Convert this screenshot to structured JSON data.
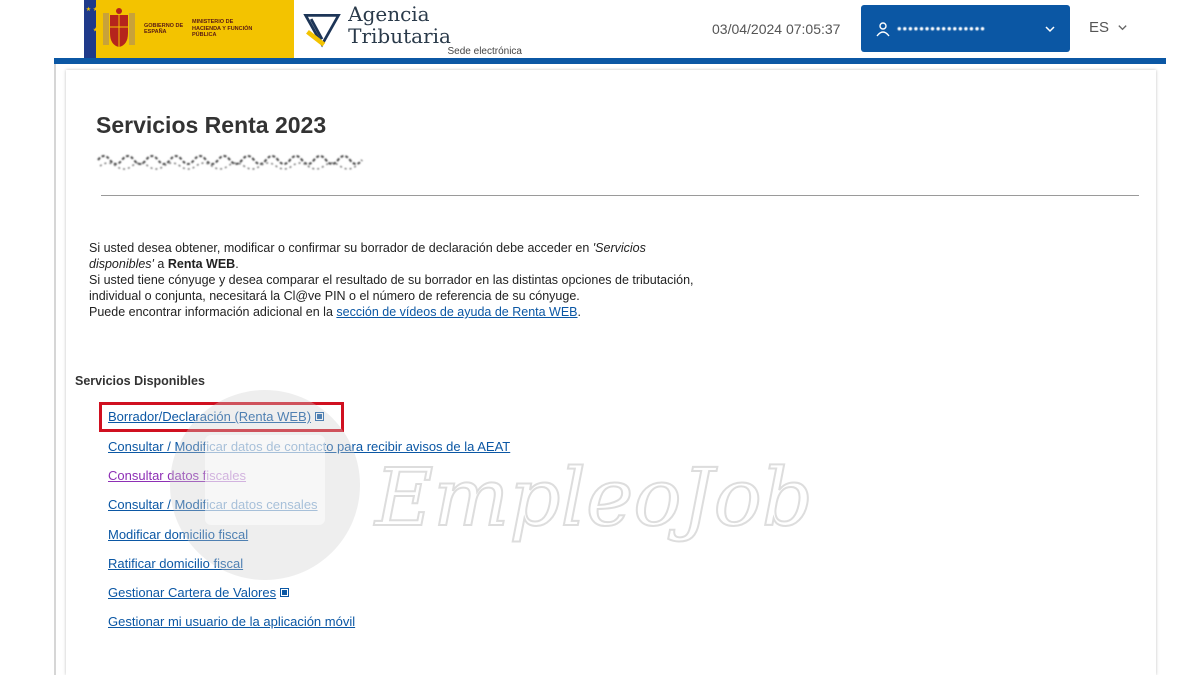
{
  "header": {
    "gov_text_1": "GOBIERNO DE ESPAÑA",
    "gov_text_2": "MINISTERIO DE HACIENDA Y FUNCIÓN PÚBLICA",
    "brand": "Agencia Tributaria",
    "brand_sub": "Sede electrónica",
    "datetime": "03/04/2024 07:05:37",
    "user_name": "••••••••••••••••",
    "language": "ES"
  },
  "main": {
    "title": "Servicios Renta 2023",
    "intro_1a": "Si usted desea obtener, modificar o confirmar su borrador de declaración debe acceder en ",
    "intro_1b": "'Servicios disponibles'",
    "intro_1c": " a ",
    "intro_1d": "Renta WEB",
    "intro_1e": ".",
    "intro_2": "Si usted tiene cónyuge y desea comparar el resultado de su borrador en las distintas opciones de tributación, individual o conjunta, necesitará la Cl@ve PIN o el número de referencia de su cónyuge.",
    "intro_3a": "Puede encontrar información adicional en la ",
    "intro_3_link": "sección de vídeos de ayuda de Renta WEB",
    "intro_3b": ".",
    "services_title": "Servicios Disponibles",
    "services": [
      "Borrador/Declaración (Renta WEB)",
      "Consultar / Modificar datos de contacto para recibir avisos de la AEAT",
      "Consultar datos fiscales",
      "Consultar / Modificar datos censales",
      "Modificar domicilio fiscal",
      "Ratificar domicilio fiscal",
      "Gestionar Cartera de Valores",
      "Gestionar mi usuario de la aplicación móvil"
    ]
  },
  "watermark": "EmpleoJob.es",
  "colors": {
    "primary_blue": "#0b57a4",
    "visited_link": "#8e2fb5",
    "highlight_red": "#d01020",
    "gov_yellow": "#f3c300"
  }
}
